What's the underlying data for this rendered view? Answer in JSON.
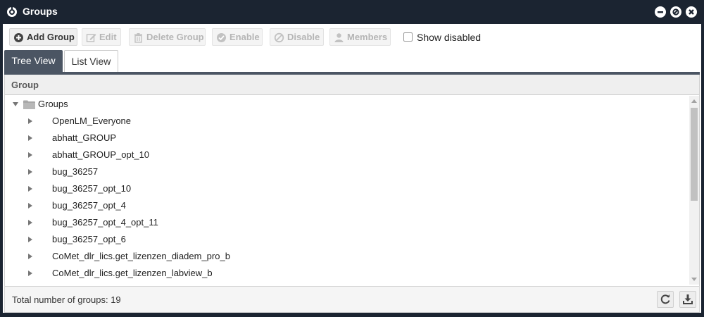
{
  "window": {
    "title": "Groups",
    "icon": "openlm-logo-icon",
    "controls": [
      "minimize-icon",
      "restore-icon",
      "close-icon"
    ]
  },
  "toolbar": {
    "add_group": "Add Group",
    "edit": "Edit",
    "delete_group": "Delete Group",
    "enable": "Enable",
    "disable": "Disable",
    "members": "Members",
    "show_disabled": "Show disabled",
    "show_disabled_checked": false
  },
  "tabs": [
    {
      "label": "Tree View",
      "selected": true
    },
    {
      "label": "List View",
      "selected": false
    }
  ],
  "grid": {
    "column_header": "Group",
    "root": {
      "label": "Groups",
      "expanded": true
    },
    "items": [
      "OpenLM_Everyone",
      "abhatt_GROUP",
      "abhatt_GROUP_opt_10",
      "bug_36257",
      "bug_36257_opt_10",
      "bug_36257_opt_4",
      "bug_36257_opt_4_opt_11",
      "bug_36257_opt_6",
      "CoMet_dlr_lics.get_lizenzen_diadem_pro_b",
      "CoMet_dlr_lics.get_lizenzen_labview_b"
    ]
  },
  "footer": {
    "total_label": "Total number of groups: 19",
    "refresh_icon": "refresh-icon",
    "export_icon": "download-icon"
  },
  "colors": {
    "titlebar": "#1b2431",
    "tab_selected": "#4b5563",
    "header_bg": "#efefef"
  }
}
